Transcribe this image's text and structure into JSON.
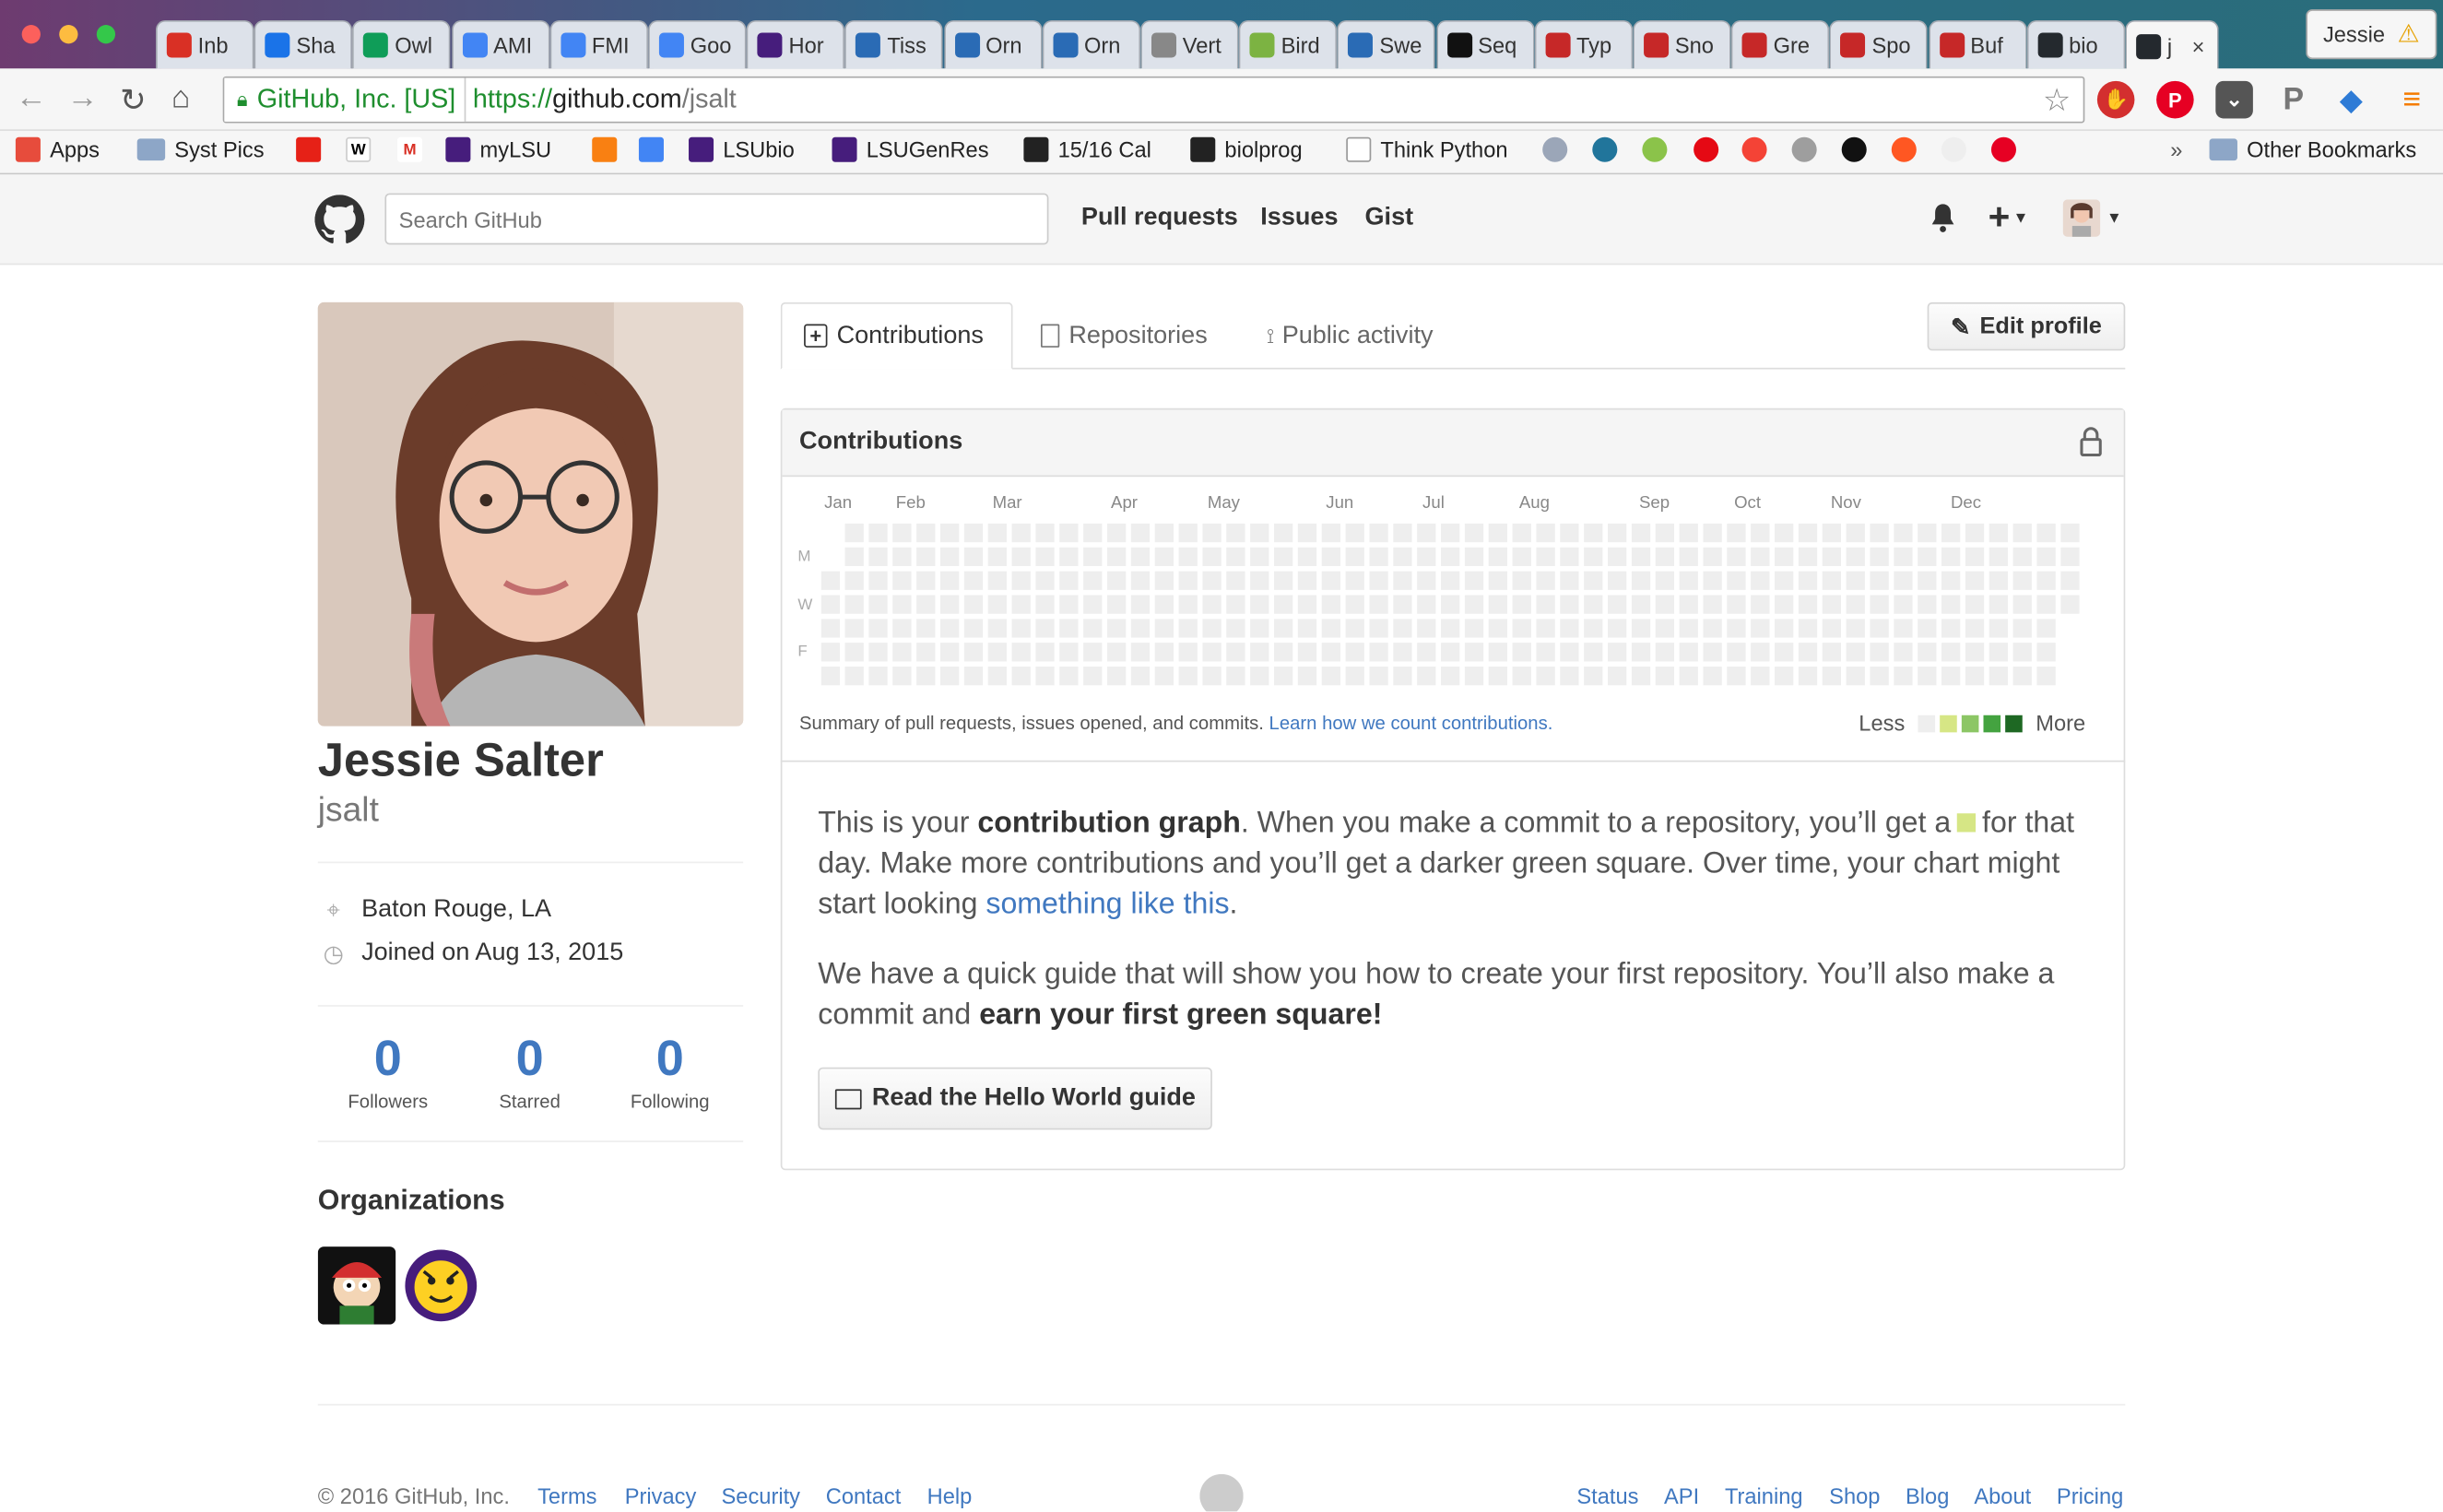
{
  "browser": {
    "tabs": [
      {
        "label": "Inb",
        "icon": "gmail-icon",
        "color": "#d93025"
      },
      {
        "label": "Sha",
        "icon": "drive-icon",
        "color": "#1a73e8"
      },
      {
        "label": "Owl",
        "icon": "sheets-icon",
        "color": "#0f9d58"
      },
      {
        "label": "AMI",
        "icon": "docs-icon",
        "color": "#4285f4"
      },
      {
        "label": "FMI",
        "icon": "docs-icon",
        "color": "#4285f4"
      },
      {
        "label": "Goo",
        "icon": "calendar-icon",
        "color": "#4285f4"
      },
      {
        "label": "Hor",
        "icon": "lsu-icon",
        "color": "#461d7c"
      },
      {
        "label": "Tiss",
        "icon": "site-icon",
        "color": "#2a6bb5"
      },
      {
        "label": "Orn",
        "icon": "site-icon",
        "color": "#2a6bb5"
      },
      {
        "label": "Orn",
        "icon": "site-icon",
        "color": "#2a6bb5"
      },
      {
        "label": "Vert",
        "icon": "page-icon",
        "color": "#888888"
      },
      {
        "label": "Bird",
        "icon": "f-icon",
        "color": "#7cb342"
      },
      {
        "label": "Swe",
        "icon": "site-icon",
        "color": "#2a6bb5"
      },
      {
        "label": "Seq",
        "icon": "wikipedia-icon",
        "color": "#111111"
      },
      {
        "label": "Typ",
        "icon": "alive-icon",
        "color": "#c62828"
      },
      {
        "label": "Sno",
        "icon": "alive-icon",
        "color": "#c62828"
      },
      {
        "label": "Gre",
        "icon": "alive-icon",
        "color": "#c62828"
      },
      {
        "label": "Spo",
        "icon": "alive-icon",
        "color": "#c62828"
      },
      {
        "label": "Buf",
        "icon": "alive-icon",
        "color": "#c62828"
      },
      {
        "label": "bio",
        "icon": "github-icon",
        "color": "#24292e"
      },
      {
        "label": "j",
        "icon": "github-icon",
        "color": "#24292e",
        "active": true
      }
    ],
    "tab_close": "×",
    "profile_name": "Jessie",
    "ev_label": "GitHub, Inc. [US]",
    "url_scheme": "https://",
    "url_host": "github.com",
    "url_path": "/jsalt",
    "bookmarks": [
      {
        "label": "Apps",
        "icon": "apps-icon"
      },
      {
        "label": "Syst Pics",
        "icon": "folder-icon"
      },
      {
        "label": "",
        "icon": "youtube-icon"
      },
      {
        "label": "",
        "icon": "wikipedia-icon"
      },
      {
        "label": "",
        "icon": "gmail-icon"
      },
      {
        "label": "myLSU",
        "icon": "lsu-icon"
      },
      {
        "label": "",
        "icon": "moodle-icon"
      },
      {
        "label": "",
        "icon": "google-scholar-icon"
      },
      {
        "label": "LSUbio",
        "icon": "lsu-icon"
      },
      {
        "label": "LSUGenRes",
        "icon": "lsu-icon"
      },
      {
        "label": "15/16 Cal",
        "icon": "g-icon"
      },
      {
        "label": "biolprog",
        "icon": "github-icon"
      },
      {
        "label": "Think Python",
        "icon": "page-icon"
      }
    ],
    "other_bookmarks": "Other Bookmarks",
    "more_chevron": "»"
  },
  "github": {
    "search_placeholder": "Search GitHub",
    "nav": [
      "Pull requests",
      "Issues",
      "Gist"
    ],
    "plus": "+",
    "profile": {
      "name": "Jessie Salter",
      "login": "jsalt",
      "location": "Baton Rouge, LA",
      "joined": "Joined on Aug 13, 2015",
      "stats": [
        {
          "num": "0",
          "label": "Followers"
        },
        {
          "num": "0",
          "label": "Starred"
        },
        {
          "num": "0",
          "label": "Following"
        }
      ],
      "orgs_title": "Organizations"
    },
    "tabs": [
      {
        "label": "Contributions",
        "selected": true
      },
      {
        "label": "Repositories"
      },
      {
        "label": "Public activity"
      }
    ],
    "edit_profile": "Edit profile",
    "contrib": {
      "title": "Contributions",
      "months": [
        "Jan",
        "Feb",
        "Mar",
        "Apr",
        "May",
        "Jun",
        "Jul",
        "Aug",
        "Sep",
        "Oct",
        "Nov",
        "Dec"
      ],
      "days": [
        "M",
        "W",
        "F"
      ],
      "summary": "Summary of pull requests, issues opened, and commits.",
      "learn_link": "Learn how we count contributions.",
      "less": "Less",
      "more": "More",
      "legend_colors": [
        "#eeeeee",
        "#d6e685",
        "#8cc665",
        "#44a340",
        "#1e6823"
      ],
      "p1_a": "This is your ",
      "p1_b": "contribution graph",
      "p1_c": ". When you make a commit to a repository, you’ll get a",
      "p1_d": "for that day. Make more contributions and you’ll get a darker green square. Over time, your chart might start looking ",
      "p1_link": "something like this",
      "p1_end": ".",
      "p2_a": "We have a quick guide that will show you how to create your first repository. You’ll also make a commit and ",
      "p2_b": "earn your first green square!",
      "hello_btn": "Read the Hello World guide"
    },
    "footer": {
      "copyright": "© 2016 GitHub, Inc.",
      "left_links": [
        "Terms",
        "Privacy",
        "Security",
        "Contact",
        "Help"
      ],
      "right_links": [
        "Status",
        "API",
        "Training",
        "Shop",
        "Blog",
        "About",
        "Pricing"
      ]
    }
  }
}
